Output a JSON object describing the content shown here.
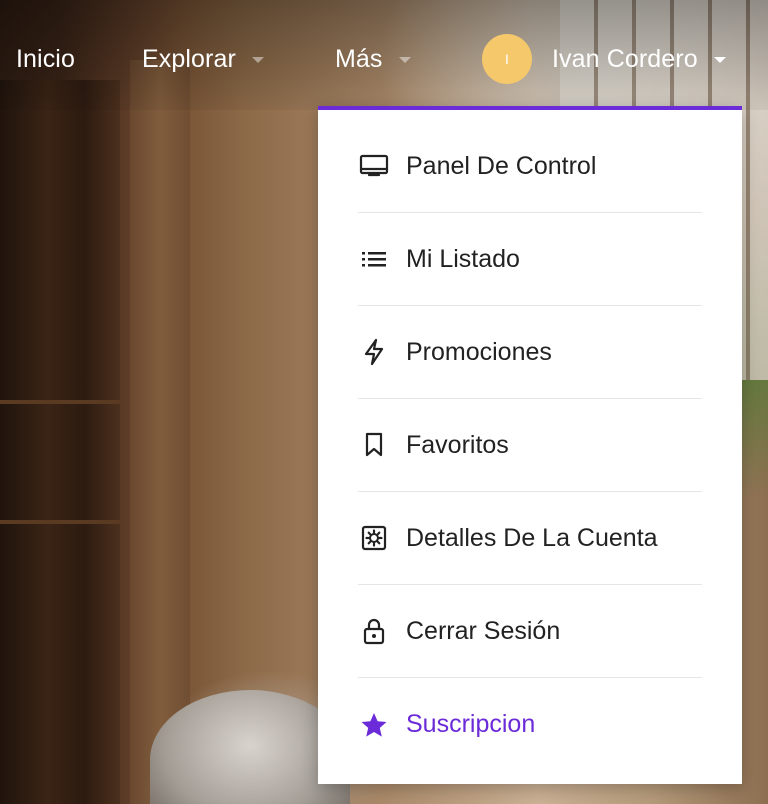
{
  "nav": {
    "inicio": "Inicio",
    "explorar": "Explorar",
    "mas": "Más",
    "user_initial": "I",
    "user_name": "Ivan Cordero"
  },
  "menu": {
    "items": [
      {
        "label": "Panel De Control",
        "icon": "laptop-icon"
      },
      {
        "label": "Mi Listado",
        "icon": "list-icon"
      },
      {
        "label": "Promociones",
        "icon": "bolt-icon"
      },
      {
        "label": "Favoritos",
        "icon": "bookmark-icon"
      },
      {
        "label": "Detalles De La Cuenta",
        "icon": "settings-box-icon"
      },
      {
        "label": "Cerrar Sesión",
        "icon": "lock-icon"
      },
      {
        "label": "Suscripcion",
        "icon": "star-icon"
      }
    ]
  },
  "colors": {
    "accent": "#6c2bd9",
    "avatar": "#f5c96b",
    "menu_text": "#222222"
  }
}
